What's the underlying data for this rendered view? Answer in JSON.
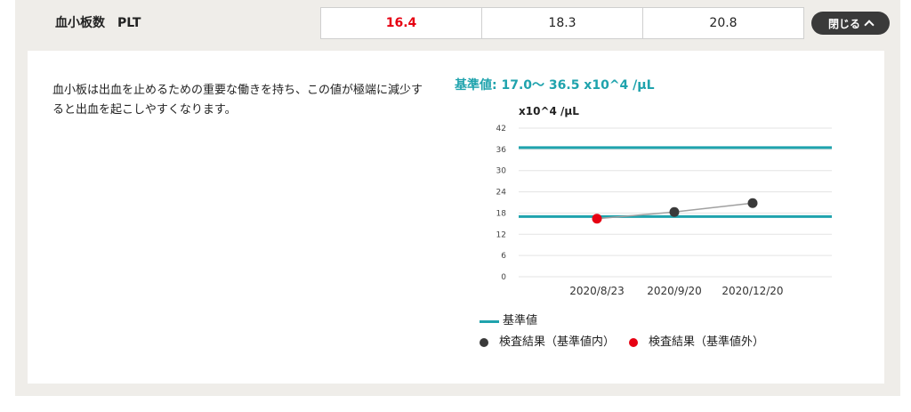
{
  "item": {
    "name": "血小板数　PLT",
    "values": [
      "16.4",
      "18.3",
      "20.8"
    ],
    "out_of_range": [
      true,
      false,
      false
    ]
  },
  "close_button": {
    "label": "閉じる",
    "icon": "chevron-up-icon"
  },
  "description": "血小板は出血を止めるための重要な働きを持ち、この値が極端に減少すると出血を起こしやすくなります。",
  "reference_title": "基準値: 17.0～ 36.5 x10^4 /μL",
  "legend": {
    "reference": "基準値",
    "within": "検査結果（基準値内）",
    "outside": "検査結果（基準値外）"
  },
  "colors": {
    "reference": "#1fa3ad",
    "within": "#3a3a3a",
    "outside": "#e60012",
    "line": "#a0a0a0"
  },
  "chart_data": {
    "type": "line",
    "ylabel": "x10^4 /μL",
    "ylim": [
      0,
      42
    ],
    "yticks": [
      0,
      6,
      12,
      18,
      24,
      30,
      36,
      42
    ],
    "categories": [
      "2020/8/23",
      "2020/9/20",
      "2020/12/20"
    ],
    "series": [
      {
        "name": "",
        "values": [
          16.4,
          18.3,
          20.8
        ],
        "out_of_range": [
          true,
          false,
          false
        ]
      }
    ],
    "reference_lines": [
      17.0,
      36.5
    ],
    "grid": true,
    "legend_position": "bottom"
  }
}
